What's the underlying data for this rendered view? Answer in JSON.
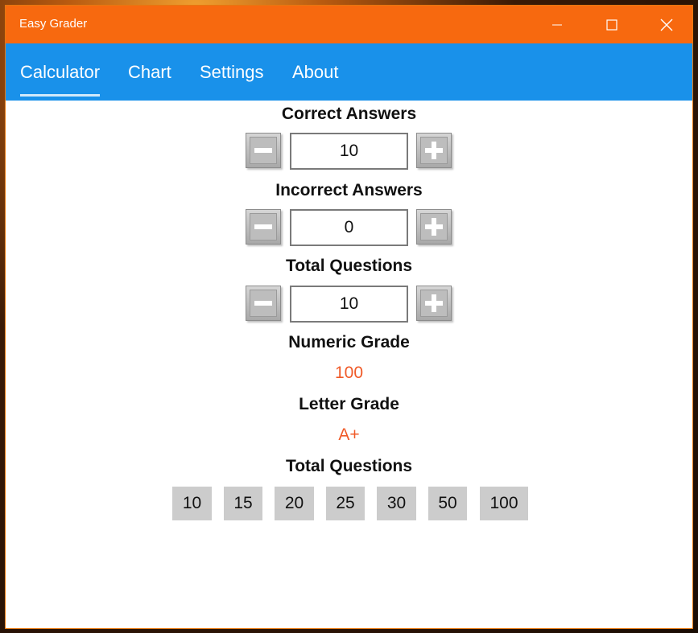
{
  "window": {
    "title": "Easy Grader",
    "accent_color": "#f7690f",
    "nav_color": "#1991ea"
  },
  "nav": {
    "tabs": [
      "Calculator",
      "Chart",
      "Settings",
      "About"
    ],
    "active": "Calculator"
  },
  "calculator": {
    "correct": {
      "label": "Correct Answers",
      "value": "10"
    },
    "incorrect": {
      "label": "Incorrect Answers",
      "value": "0"
    },
    "total": {
      "label": "Total Questions",
      "value": "10"
    },
    "numeric_grade": {
      "label": "Numeric Grade",
      "value": "100"
    },
    "letter_grade": {
      "label": "Letter Grade",
      "value": "A+"
    },
    "presets": {
      "label": "Total Questions",
      "values": [
        "10",
        "15",
        "20",
        "25",
        "30",
        "50",
        "100"
      ]
    },
    "grade_color": "#f05a28"
  },
  "icons": {
    "minimize": "minimize-icon",
    "maximize": "maximize-icon",
    "close": "close-icon",
    "decrement": "minus-icon",
    "increment": "plus-icon"
  }
}
